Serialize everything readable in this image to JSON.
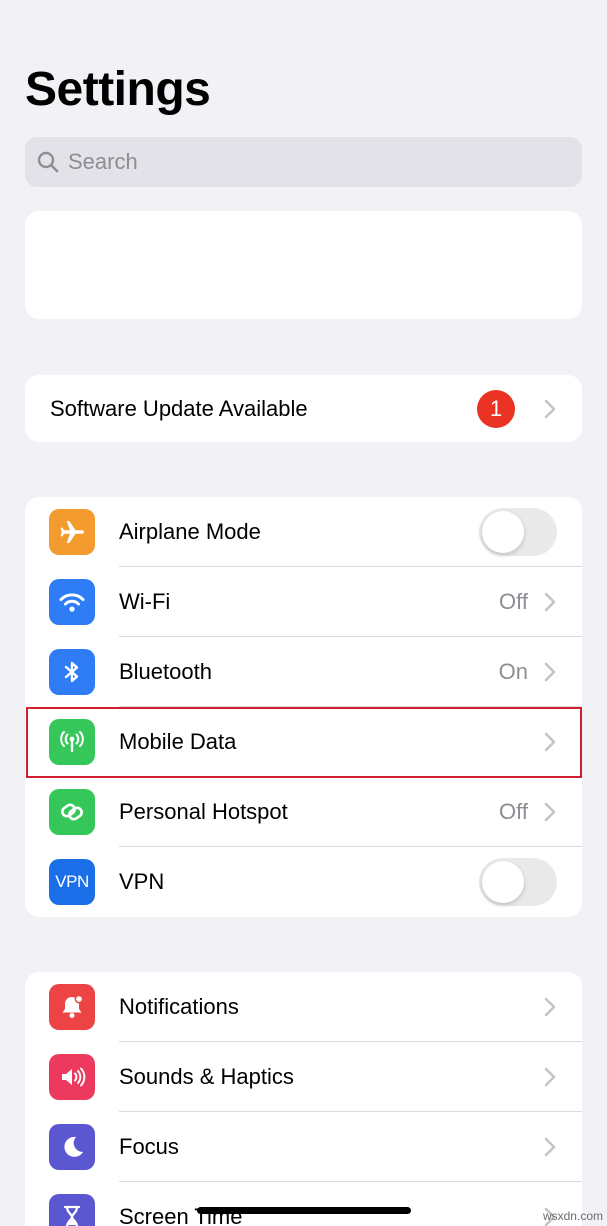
{
  "header": {
    "title": "Settings"
  },
  "search": {
    "placeholder": "Search"
  },
  "software_update": {
    "label": "Software Update Available",
    "badge": "1"
  },
  "connectivity": [
    {
      "label": "Airplane Mode",
      "icon": "airplane-icon",
      "color": "#f49b2f",
      "control": "toggle",
      "on": false
    },
    {
      "label": "Wi-Fi",
      "icon": "wifi-icon",
      "color": "#2e7cf6",
      "value": "Off"
    },
    {
      "label": "Bluetooth",
      "icon": "bluetooth-icon",
      "color": "#2e7cf6",
      "value": "On"
    },
    {
      "label": "Mobile Data",
      "icon": "antenna-icon",
      "color": "#35c759",
      "value": ""
    },
    {
      "label": "Personal Hotspot",
      "icon": "hotspot-link-icon",
      "color": "#35c759",
      "value": "Off"
    },
    {
      "label": "VPN",
      "icon_text": "VPN",
      "color": "#1a6ee8",
      "control": "toggle",
      "on": false
    }
  ],
  "notifications_group": [
    {
      "label": "Notifications",
      "icon": "bell-icon",
      "color": "#ec4444"
    },
    {
      "label": "Sounds & Haptics",
      "icon": "speaker-icon",
      "color": "#ec3a5e"
    },
    {
      "label": "Focus",
      "icon": "moon-icon",
      "color": "#5b57d1"
    },
    {
      "label": "Screen Time",
      "icon": "hourglass-icon",
      "color": "#5b57d1"
    }
  ],
  "watermark": "wsxdn.com"
}
